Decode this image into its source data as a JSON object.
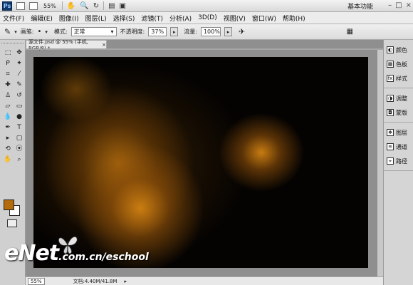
{
  "appbar": {
    "logo": "Ps",
    "zoom": "55%",
    "workspace": "基本功能"
  },
  "menu": [
    "文件(F)",
    "编辑(E)",
    "图像(I)",
    "图层(L)",
    "选择(S)",
    "滤镜(T)",
    "分析(A)",
    "3D(D)",
    "视图(V)",
    "窗口(W)",
    "帮助(H)"
  ],
  "options": {
    "brush_label": "画笔:",
    "mode_label": "模式:",
    "mode_value": "正常",
    "opacity_label": "不透明度:",
    "opacity_value": "37%",
    "flow_label": "流量:",
    "flow_value": "100%"
  },
  "document": {
    "tab_title": "源文件.psd @ 55% (手机, RGB/8) *",
    "close": "×"
  },
  "status": {
    "zoom": "55%",
    "doc": "文档:4.40M/41.8M"
  },
  "panels": [
    {
      "items": [
        {
          "icon": "color-icon",
          "label": "颜色"
        },
        {
          "icon": "swatches-icon",
          "label": "色板"
        },
        {
          "icon": "styles-icon",
          "label": "样式"
        }
      ]
    },
    {
      "items": [
        {
          "icon": "adjustments-icon",
          "label": "调整"
        },
        {
          "icon": "masks-icon",
          "label": "蒙版"
        }
      ]
    },
    {
      "items": [
        {
          "icon": "layers-icon",
          "label": "图层"
        },
        {
          "icon": "channels-icon",
          "label": "通道"
        },
        {
          "icon": "paths-icon",
          "label": "路径"
        }
      ]
    }
  ],
  "watermark": {
    "main": "eNet",
    "domain": ".com.cn/eschool"
  },
  "colors": {
    "foreground": "#b36b0c",
    "background": "#ffffff"
  }
}
